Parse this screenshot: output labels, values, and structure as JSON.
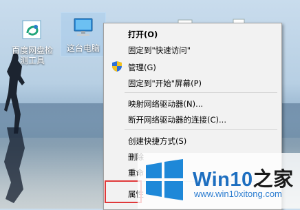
{
  "desktop": {
    "icons": [
      {
        "label_line1": "百度网盘检",
        "label_line2": "测工具",
        "icon": "baidu-netdisk-check-icon"
      },
      {
        "label_line1": "这台电脑",
        "icon": "computer-icon",
        "selected": true
      }
    ]
  },
  "context_menu": {
    "items": [
      {
        "label": "打开(O)",
        "bold": true
      },
      {
        "label": "固定到\"快速访问\""
      },
      {
        "label": "管理(G)",
        "icon": "uac-shield-icon"
      },
      {
        "label": "固定到\"开始\"屏幕(P)"
      },
      {
        "label": "映射网络驱动器(N)..."
      },
      {
        "label": "断开网络驱动器的连接(C)..."
      },
      {
        "label": "创建快捷方式(S)"
      },
      {
        "label": "删除"
      },
      {
        "label": "重命"
      },
      {
        "label": "属性"
      }
    ]
  },
  "watermark": {
    "title_main": "Win10",
    "title_suffix": "之家",
    "url": "www.win10xitong.com",
    "logo_color": "#1e88d8"
  },
  "colors": {
    "highlight": "#e0393a",
    "menu_bg": "#f2f2f2"
  }
}
